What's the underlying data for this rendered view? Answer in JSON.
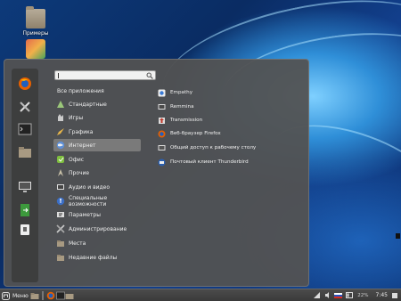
{
  "desktop": {
    "icons": [
      {
        "label": "Примеры",
        "icon": "folder-icon"
      },
      {
        "label": "",
        "icon": "package-icon"
      }
    ]
  },
  "menu": {
    "search": {
      "value": "",
      "placeholder": ""
    },
    "favorites": [
      "firefox-icon",
      "tools-icon",
      "terminal-icon",
      "files-icon",
      "monitor-icon",
      "logout-icon",
      "shutdown-icon"
    ],
    "categories": [
      {
        "label": "Все приложения",
        "icon": "",
        "selected": false
      },
      {
        "label": "Стандартные",
        "icon": "accessories-icon",
        "selected": false
      },
      {
        "label": "Игры",
        "icon": "games-icon",
        "selected": false
      },
      {
        "label": "Графика",
        "icon": "graphics-icon",
        "selected": false
      },
      {
        "label": "Интернет",
        "icon": "internet-icon",
        "selected": true
      },
      {
        "label": "Офис",
        "icon": "office-icon",
        "selected": false
      },
      {
        "label": "Прочие",
        "icon": "other-icon",
        "selected": false
      },
      {
        "label": "Аудио и видео",
        "icon": "multimedia-icon",
        "selected": false
      },
      {
        "label": "Специальные возможности",
        "icon": "accessibility-icon",
        "selected": false
      },
      {
        "label": "Параметры",
        "icon": "settings-icon",
        "selected": false
      },
      {
        "label": "Администрирование",
        "icon": "admin-icon",
        "selected": false
      },
      {
        "label": "Места",
        "icon": "places-icon",
        "selected": false
      },
      {
        "label": "Недавние файлы",
        "icon": "recent-icon",
        "selected": false
      }
    ],
    "apps": [
      {
        "label": "Empathy",
        "icon": "empathy-icon"
      },
      {
        "label": "Remmina",
        "icon": "remmina-icon"
      },
      {
        "label": "Transmission",
        "icon": "transmission-icon"
      },
      {
        "label": "Веб-браузер Firefox",
        "icon": "firefox-icon"
      },
      {
        "label": "Общий доступ к рабочему столу",
        "icon": "desktop-share-icon"
      },
      {
        "label": "Почтовый клиент Thunderbird",
        "icon": "thunderbird-icon"
      }
    ]
  },
  "panel": {
    "menu_label": "Меню",
    "battery": "22%",
    "time": "7:45"
  }
}
